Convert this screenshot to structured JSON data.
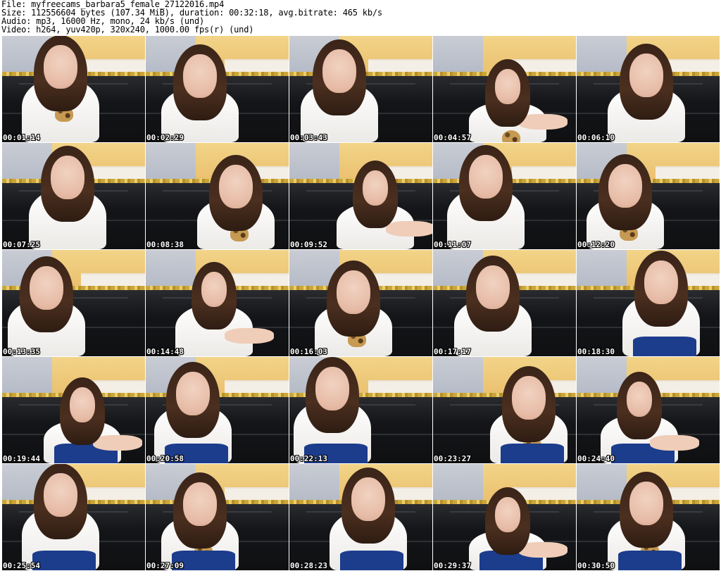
{
  "header": {
    "file": "File: myfreecams_barbara5_female_27122016.mp4",
    "size": "Size: 112556604 bytes (107.34 MiB), duration: 00:32:18, avg.bitrate: 465 kb/s",
    "audio": "Audio: mp3, 16000 Hz, mono, 24 kb/s (und)",
    "video": "Video: h264, yuv420p, 320x240, 1000.00 fps(r) (und)"
  },
  "thumbnails": [
    {
      "time": "00:01:14"
    },
    {
      "time": "00:02:29"
    },
    {
      "time": "00:03:43"
    },
    {
      "time": "00:04:57"
    },
    {
      "time": "00:06:10"
    },
    {
      "time": "00:07:25"
    },
    {
      "time": "00:08:38"
    },
    {
      "time": "00:09:52"
    },
    {
      "time": "00:11:07"
    },
    {
      "time": "00:12:20"
    },
    {
      "time": "00:13:35"
    },
    {
      "time": "00:14:48"
    },
    {
      "time": "00:16:03"
    },
    {
      "time": "00:17:17"
    },
    {
      "time": "00:18:30"
    },
    {
      "time": "00:19:44"
    },
    {
      "time": "00:20:58"
    },
    {
      "time": "00:22:13"
    },
    {
      "time": "00:23:27"
    },
    {
      "time": "00:24:40"
    },
    {
      "time": "00:25:54"
    },
    {
      "time": "00:27:09"
    },
    {
      "time": "00:28:23"
    },
    {
      "time": "00:29:37"
    },
    {
      "time": "00:30:50"
    }
  ]
}
